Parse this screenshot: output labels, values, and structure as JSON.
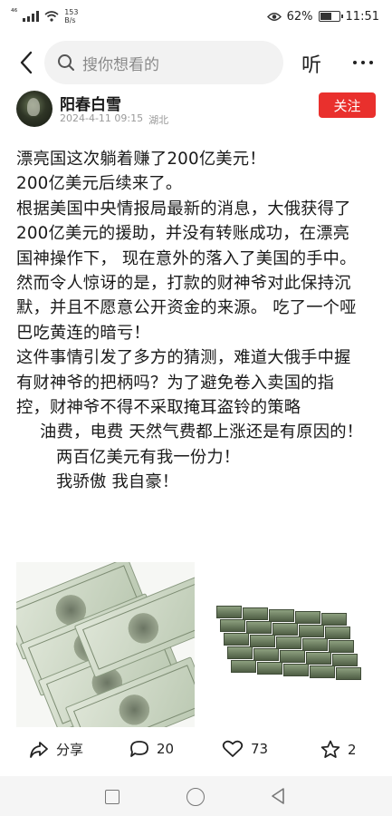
{
  "status_bar": {
    "signal_label": "⁴⁶",
    "net_speed_value": "153",
    "net_speed_unit": "B/s",
    "battery_percent": "62%",
    "battery_level": 0.62,
    "time": "11:51",
    "icons": [
      "signal-icon",
      "wifi-icon",
      "eye-icon",
      "battery-icon"
    ]
  },
  "top_bar": {
    "search_placeholder": "搜你想看的",
    "listen_label": "听",
    "icons": [
      "back-icon",
      "search-icon",
      "more-icon"
    ]
  },
  "author": {
    "name": "阳春白雪",
    "date": "2024-4-11 09:15",
    "location": "湖北",
    "follow_label": "关注"
  },
  "post": {
    "lines": [
      "漂亮国这次躺着赚了200亿美元！",
      "200亿美元后续来了。",
      "根据美国中央情报局最新的消息，大俄获得了",
      "200亿美元的援助，并没有转账成功，在漂亮",
      "国神操作下， 现在意外的落入了美国的手中。",
      "然而令人惊讶的是，打款的财神爷对此保持沉",
      "默，并且不愿意公开资金的来源。 吃了一个哑",
      "巴吃黄连的暗亏！",
      "这件事情引发了多方的猜测，难道大俄手中握",
      "有财神爷的把柄吗？为了避免卷入卖国的指",
      "控，财神爷不得不采取掩耳盗铃的策略",
      "油费，电费 天然气费都上涨还是有原因的！",
      "两百亿美元有我一份力！",
      "我骄傲 我自豪！"
    ]
  },
  "actions": {
    "share_label": "分享",
    "comment_count": "20",
    "like_count": "73",
    "favorite_count": "2"
  },
  "colors": {
    "follow_button": "#e9302d",
    "text": "#1a1a1a",
    "meta": "#9a9a9a",
    "search_bg": "#f2f2f2"
  }
}
